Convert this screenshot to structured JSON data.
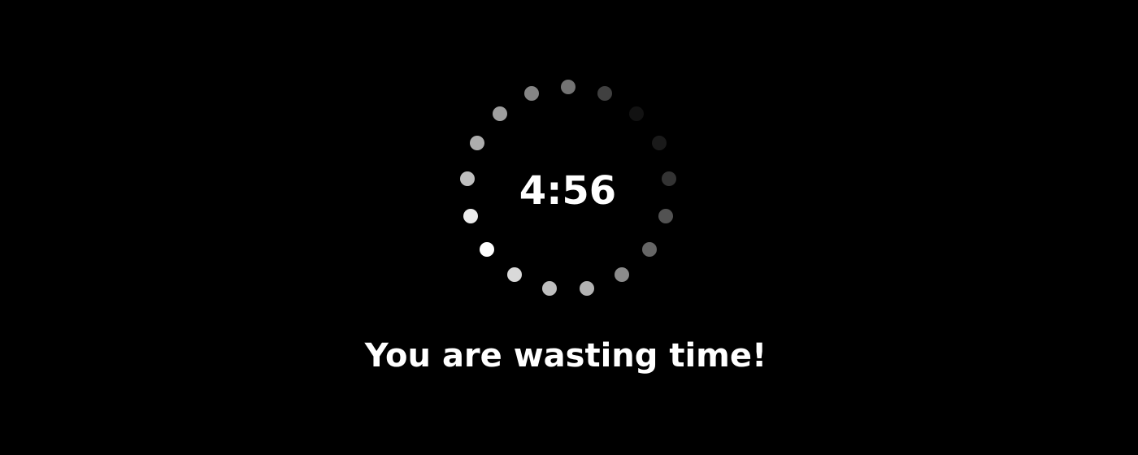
{
  "timer": {
    "remaining": "4:56"
  },
  "message": {
    "text": "You are wasting time!"
  },
  "spinner": {
    "icon": "loading-spinner-icon",
    "dot_color": "#ffffff",
    "dot_opacities": [
      0.45,
      0.25,
      0.07,
      0.1,
      0.2,
      0.32,
      0.4,
      0.55,
      0.7,
      0.75,
      0.85,
      1.0,
      0.92,
      0.75,
      0.68,
      0.62,
      0.52
    ]
  },
  "colors": {
    "background": "#000000",
    "text": "#ffffff"
  }
}
